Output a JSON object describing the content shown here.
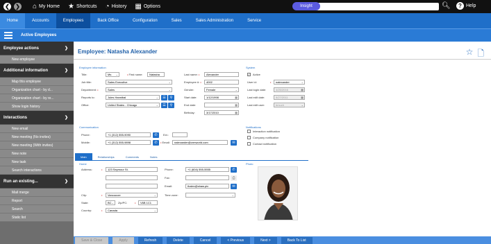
{
  "topbar": {
    "home": "My Home",
    "shortcuts": "Shortcuts",
    "history": "History",
    "options": "Options",
    "insight": "Insight",
    "help": "Help"
  },
  "menu": [
    "Home",
    "Accounts",
    "Employees",
    "Back Office",
    "Configuration",
    "Sales",
    "Sales Administration",
    "Service"
  ],
  "subbar": {
    "title": "Active Employees"
  },
  "sidebar": {
    "employee_actions": "Employee actions",
    "new_employee": "New employee",
    "additional_information": "Additional information",
    "map_employee": "Map this employee",
    "org_chart_1": "Organization chart - by d...",
    "org_chart_2": "Organization chart - by re...",
    "show_login_history": "Show login history",
    "interactions": "Interactions",
    "new_email": "New email",
    "new_meeting_no": "New meeting (No invites)",
    "new_meeting_with": "New meeting (With invites)",
    "new_note": "New note",
    "new_task": "New task",
    "search_interactions": "Search interactions",
    "run_existing": "Run an existing...",
    "mail_merge": "Mail merge",
    "report": "Report",
    "search": "Search",
    "static_list": "Static list"
  },
  "page": {
    "title": "Employee: Natasha Alexander"
  },
  "employee_info": {
    "section": "Employee information",
    "title_label": "Title:",
    "title_value": "Ms",
    "first_name_label": "First name:",
    "first_name_value": "Natasha",
    "last_name_label": "Last name:",
    "last_name_value": "Alexander",
    "job_title_label": "Job title:",
    "job_title_value": "Sales Executive",
    "employee_no_label": "Employee #:",
    "employee_no_value": "4002",
    "department_label": "Department:",
    "department_value": "Sales",
    "gender_label": "Gender:",
    "gender_value": "Female",
    "reports_to_label": "Reports to:",
    "reports_to_value": "Jules Hannibal",
    "start_date_label": "Start date:",
    "start_date_value": "1/12/1998",
    "office_label": "Office:",
    "office_value": "United States - Chicago",
    "end_date_label": "End date:",
    "end_date_value": "",
    "birthday_label": "Birthday:",
    "birthday_value": "3/17/2010"
  },
  "system": {
    "section": "System",
    "active_label": "Active",
    "user_id_label": "User id:",
    "user_id_value": "nalexander",
    "last_login_label": "Last login date:",
    "last_login_value": "4/25/2016",
    "last_edit_date_label": "Last edit date:",
    "last_edit_date_value": "5/27/2011",
    "last_edit_user_label": "Last edit user:",
    "last_edit_user_value": "bmuch"
  },
  "communication": {
    "section": "Communication",
    "phone_label": "Phone:",
    "phone_value": "+1 (312) 555-9090",
    "ext_label": "Ext.:",
    "ext_value": "",
    "mobile_label": "Mobile:",
    "mobile_value": "+1 (312) 555-9898",
    "email_label": "Email:",
    "email_value": "nalexander@crmworld.com"
  },
  "notifications": {
    "section": "Notifications",
    "items": [
      "Interaction notification",
      "Company notification",
      "Contact notification"
    ]
  },
  "tabs": [
    "Main",
    "Relationships",
    "Comments",
    "Notes"
  ],
  "home": {
    "section": "Home",
    "address_label": "Address:",
    "address_value": "123 Seymour St.",
    "city_label": "City:",
    "city_value": "Vancouver",
    "state_label": "State:",
    "state_value": "BC",
    "zip_label": "Zip/PC:",
    "zip_value": "V6B 1C1",
    "country_label": "Country:",
    "country_value": "Canada",
    "phone_label": "Phone:",
    "phone_value": "+1 (604) 555-5555",
    "fax_label": "Fax:",
    "fax_value": "",
    "email_label": "Email:",
    "email_value": "thalex@shaw.pix",
    "timezone_label": "Time zone:",
    "timezone_value": ""
  },
  "photo": {
    "section": "Photo"
  },
  "bottom": [
    "Save & Close",
    "Apply",
    "Refresh",
    "Delete",
    "Cancel",
    "< Previous",
    "Next >",
    "Back To List"
  ]
}
